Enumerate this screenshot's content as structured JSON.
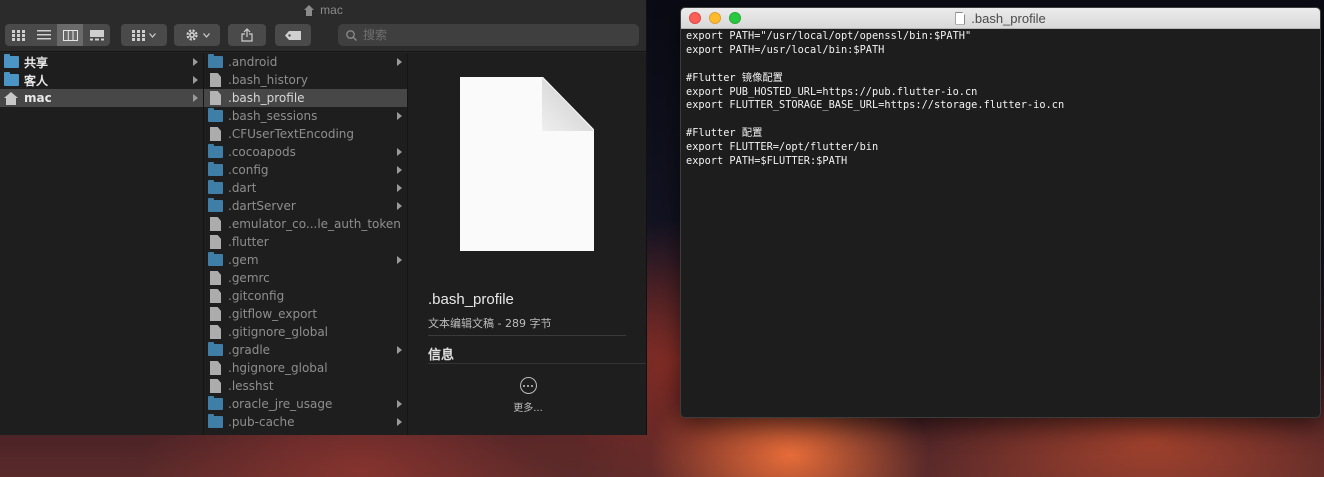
{
  "finder": {
    "title": "mac",
    "search_placeholder": "搜索",
    "sidebar_items": [
      {
        "label": "共享",
        "icon": "folder-icon"
      },
      {
        "label": "客人",
        "icon": "folder-icon"
      },
      {
        "label": "mac",
        "icon": "home-icon",
        "selected": true
      }
    ],
    "files": [
      {
        "name": ".android",
        "type": "folder"
      },
      {
        "name": ".bash_history",
        "type": "file"
      },
      {
        "name": ".bash_profile",
        "type": "file",
        "selected": true
      },
      {
        "name": ".bash_sessions",
        "type": "folder"
      },
      {
        "name": ".CFUserTextEncoding",
        "type": "file"
      },
      {
        "name": ".cocoapods",
        "type": "folder"
      },
      {
        "name": ".config",
        "type": "folder"
      },
      {
        "name": ".dart",
        "type": "folder"
      },
      {
        "name": ".dartServer",
        "type": "folder"
      },
      {
        "name": ".emulator_co...le_auth_token",
        "type": "file"
      },
      {
        "name": ".flutter",
        "type": "file"
      },
      {
        "name": ".gem",
        "type": "folder"
      },
      {
        "name": ".gemrc",
        "type": "file"
      },
      {
        "name": ".gitconfig",
        "type": "file"
      },
      {
        "name": ".gitflow_export",
        "type": "file"
      },
      {
        "name": ".gitignore_global",
        "type": "file"
      },
      {
        "name": ".gradle",
        "type": "folder"
      },
      {
        "name": ".hgignore_global",
        "type": "file"
      },
      {
        "name": ".lesshst",
        "type": "file"
      },
      {
        "name": ".oracle_jre_usage",
        "type": "folder"
      },
      {
        "name": ".pub-cache",
        "type": "folder"
      }
    ],
    "preview": {
      "name": ".bash_profile",
      "meta": "文本编辑文稿 - 289 字节",
      "info_heading": "信息",
      "more_label": "更多..."
    }
  },
  "terminal": {
    "title": ".bash_profile",
    "lines": [
      "export PATH=\"/usr/local/opt/openssl/bin:$PATH\"",
      "export PATH=/usr/local/bin:$PATH",
      "",
      "#Flutter 镜像配置",
      "export PUB_HOSTED_URL=https://pub.flutter-io.cn",
      "export FLUTTER_STORAGE_BASE_URL=https://storage.flutter-io.cn",
      "",
      "#Flutter 配置",
      "export FLUTTER=/opt/flutter/bin",
      "export PATH=$FLUTTER:$PATH"
    ]
  }
}
